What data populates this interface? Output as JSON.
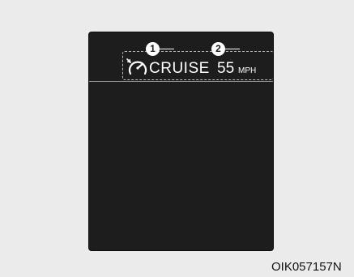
{
  "display": {
    "cruise_label": "CRUISE",
    "set_speed": "55",
    "speed_unit": "MPH",
    "icon": "cruise-control-speedometer-icon"
  },
  "callouts": {
    "marker_1": "1",
    "marker_2": "2"
  },
  "figure_code": "OIK057157N",
  "colors": {
    "background": "#ebebeb",
    "screen": "#1d1d1d",
    "text": "#ffffff"
  }
}
